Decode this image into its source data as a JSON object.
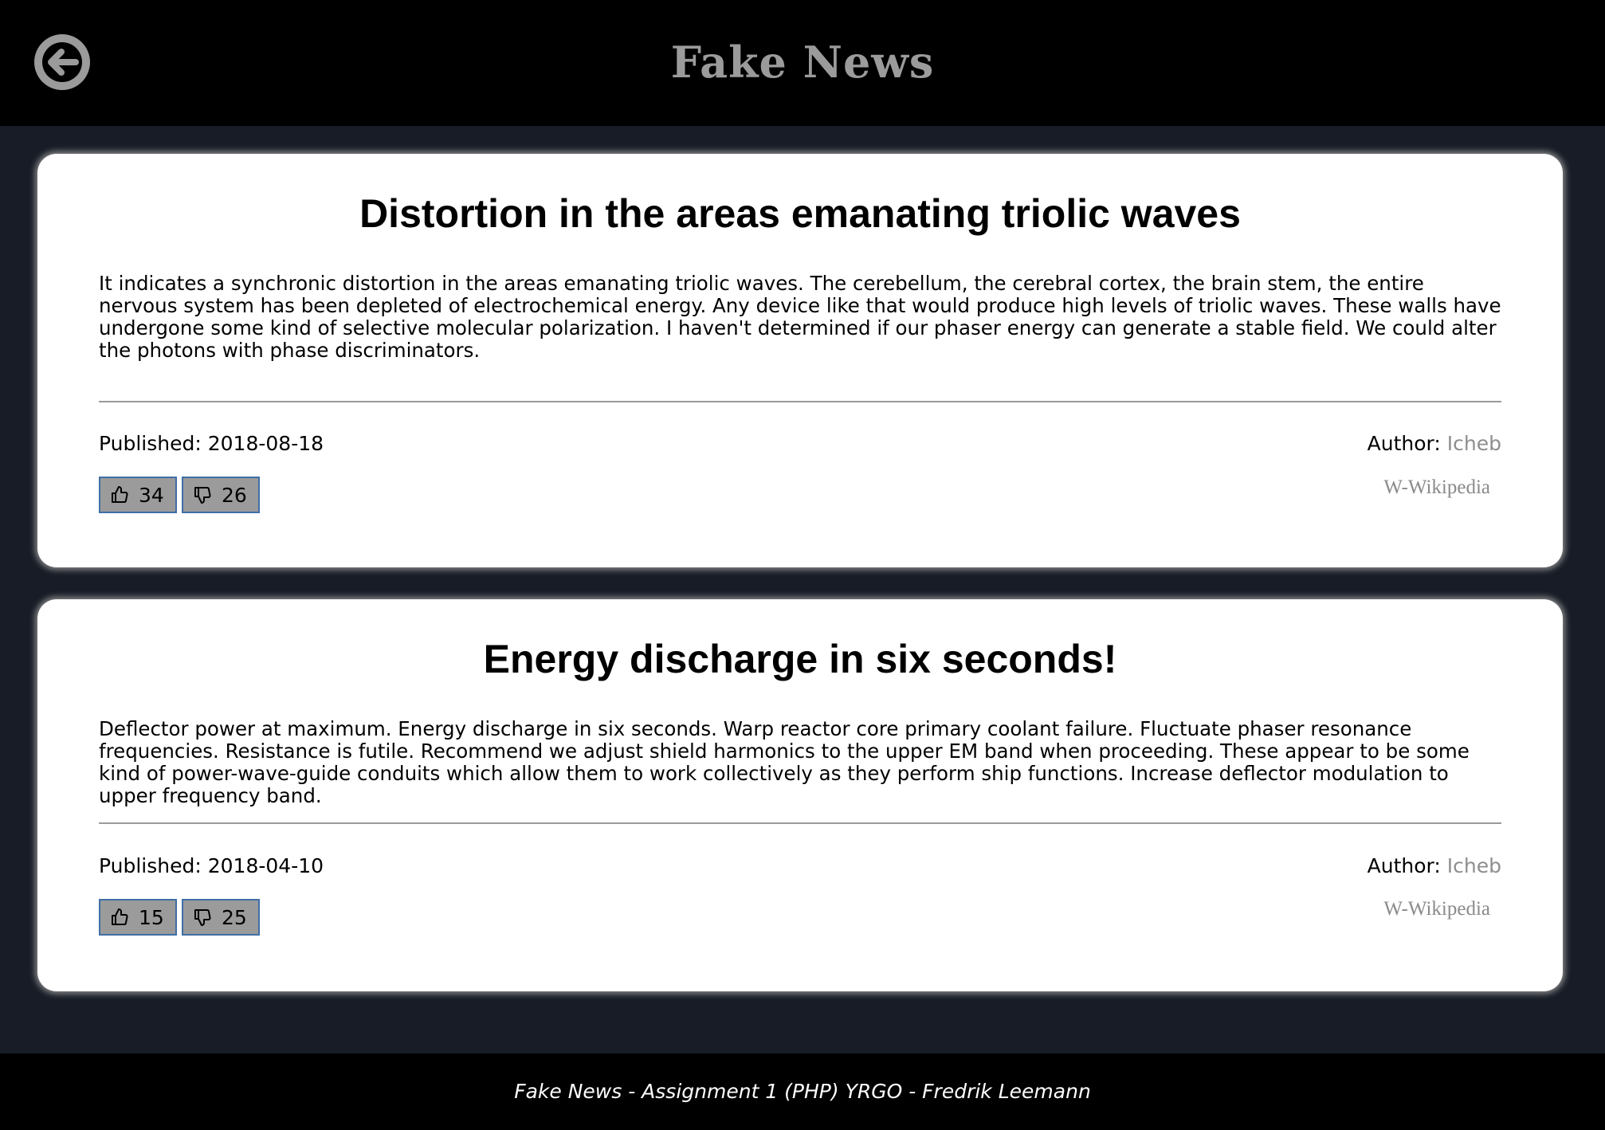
{
  "header": {
    "title": "Fake News",
    "back_icon": "arrow-left-circle-icon"
  },
  "articles": [
    {
      "title": "Distortion in the areas emanating triolic waves",
      "body": "It indicates a synchronic distortion in the areas emanating triolic waves. The cerebellum, the cerebral cortex, the brain stem, the entire nervous system has been depleted of electrochemical energy. Any device like that would produce high levels of triolic waves. These walls have undergone some kind of selective molecular polarization. I haven't determined if our phaser energy can generate a stable field. We could alter the photons with phase discriminators.",
      "published_label": "Published:",
      "published_date": "2018-08-18",
      "author_label": "Author:",
      "author_name": "Icheb",
      "source_link": "W-Wikipedia",
      "likes": "34",
      "dislikes": "26"
    },
    {
      "title": "Energy discharge in six seconds!",
      "body": "Deflector power at maximum. Energy discharge in six seconds. Warp reactor core primary coolant failure. Fluctuate phaser resonance frequencies. Resistance is futile. Recommend we adjust shield harmonics to the upper EM band when proceeding. These appear to be some kind of power-wave-guide conduits which allow them to work collectively as they perform ship functions. Increase deflector modulation to upper frequency band.",
      "published_label": "Published:",
      "published_date": "2018-04-10",
      "author_label": "Author:",
      "author_name": "Icheb",
      "source_link": "W-Wikipedia",
      "likes": "15",
      "dislikes": "25"
    }
  ],
  "footer": {
    "text": "Fake News - Assignment 1 (PHP) YRGO - Fredrik Leemann"
  },
  "colors": {
    "page_background": "#171c26",
    "header_background": "#000000",
    "title_gray": "#9b9b9b",
    "vote_button_border": "#3f6fa6",
    "vote_button_fill": "#9b9b9b"
  }
}
